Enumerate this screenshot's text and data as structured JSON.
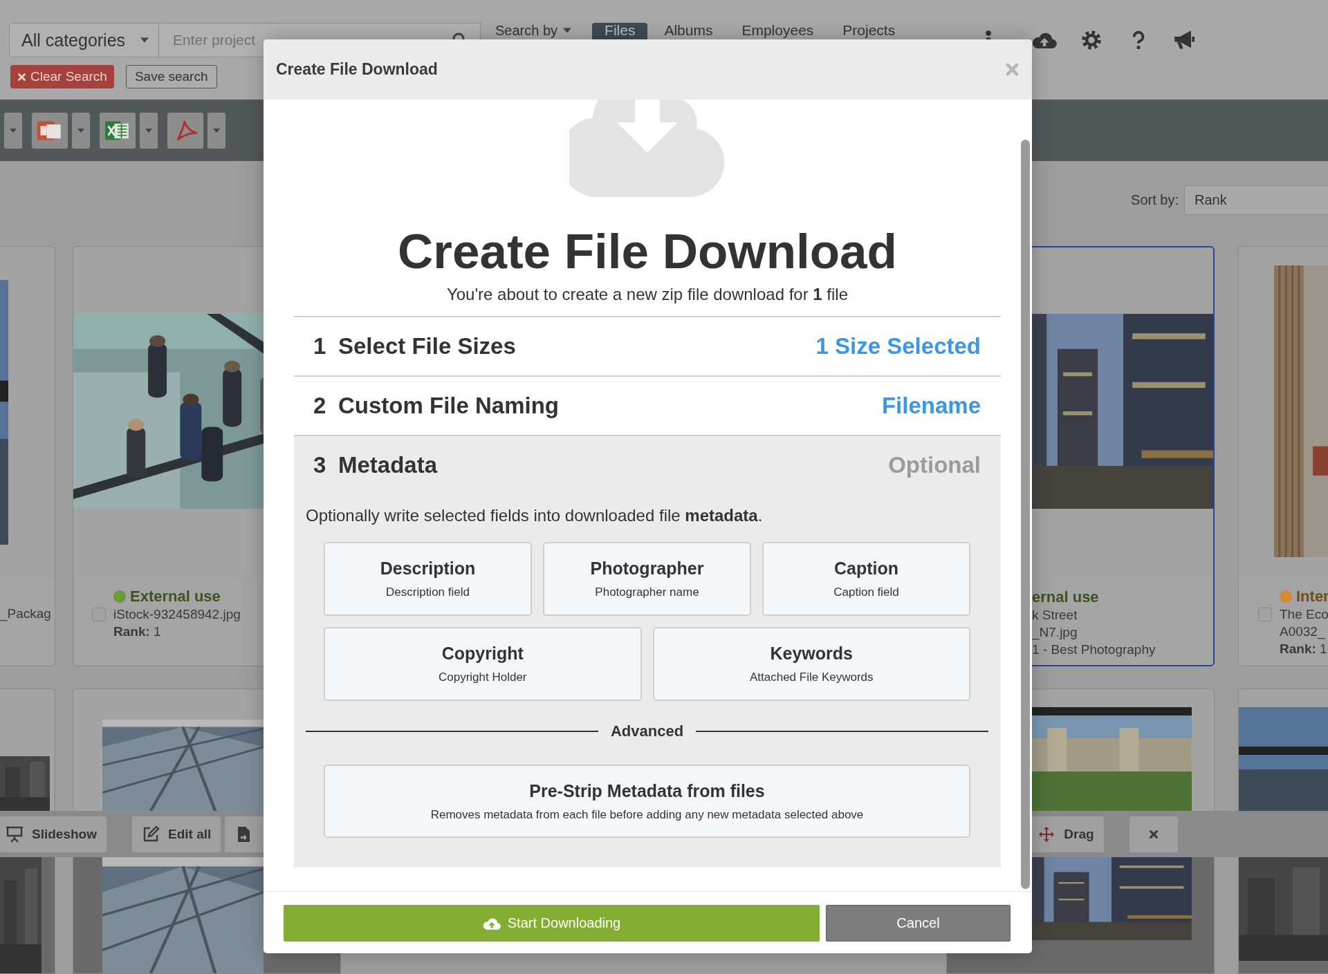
{
  "topbar": {
    "category": "All categories",
    "search": {
      "placeholder": "Enter project"
    },
    "search_by": "Search by",
    "tabs": [
      {
        "label": "Files",
        "selected": true
      },
      {
        "label": "Albums",
        "selected": false
      },
      {
        "label": "Employees",
        "selected": false
      },
      {
        "label": "Projects",
        "selected": false
      }
    ],
    "clear_button": "Clear Search",
    "save_button": "Save search"
  },
  "sort": {
    "label": "Sort by:",
    "value": "Rank"
  },
  "cards": [
    {
      "lines": [
        "_Packag"
      ]
    },
    {
      "checked": false,
      "status": {
        "label": "External use",
        "color": "#6b9a3c"
      },
      "lines": [
        "iStock-932458942.jpg",
        "**Rank:** 1"
      ]
    },
    {
      "highlighted": true,
      "status": {
        "label": "ernal use"
      },
      "lines": [
        "k Street",
        "_N7.jpg",
        "1 - Best Photography"
      ]
    },
    {
      "checked": false,
      "status": {
        "label": "Inter",
        "color": "#d38a37"
      },
      "lines": [
        "The Eco",
        "A0032_",
        "**Rank:** 1"
      ]
    }
  ],
  "action_bar": [
    {
      "kind": "slideshow",
      "label": "Slideshow"
    },
    {
      "kind": "edit",
      "label": "Edit all"
    },
    {
      "kind": "export"
    },
    {
      "kind": "drag",
      "label": "Drag"
    },
    {
      "kind": "close"
    }
  ],
  "dialog": {
    "title": "Create File Download",
    "heading": "Create File Download",
    "subtitle": "You're about to create a new zip file download for **1** file",
    "steps": [
      {
        "number": "1",
        "label": "Select File Sizes",
        "status": "1 Size Selected",
        "complete": true,
        "expanded": false
      },
      {
        "number": "2",
        "label": "Custom File Naming",
        "status": "Filename",
        "complete": true,
        "expanded": false
      },
      {
        "number": "3",
        "label": "Metadata",
        "status": "Optional",
        "complete": false,
        "expanded": true
      }
    ],
    "metadata": {
      "intro": "Optionally write selected fields into downloaded file **metadata**.",
      "fields": [
        {
          "label": "Description",
          "hint": "Description field",
          "selected": false
        },
        {
          "label": "Photographer",
          "hint": "Photographer name",
          "selected": false
        },
        {
          "label": "Caption",
          "hint": "Caption field",
          "selected": false
        },
        {
          "label": "Copyright",
          "hint": "Copyright Holder",
          "selected": false
        },
        {
          "label": "Keywords",
          "hint": "Attached File Keywords",
          "selected": false
        }
      ],
      "advanced_label": "Advanced",
      "advanced_options": [
        {
          "label": "Pre-Strip Metadata from files",
          "hint": "Removes metadata from each file before adding any new metadata selected above",
          "selected": false
        }
      ]
    },
    "buttons": [
      {
        "kind": "primary",
        "label": "Start Downloading"
      },
      {
        "kind": "secondary",
        "label": "Cancel"
      }
    ]
  }
}
